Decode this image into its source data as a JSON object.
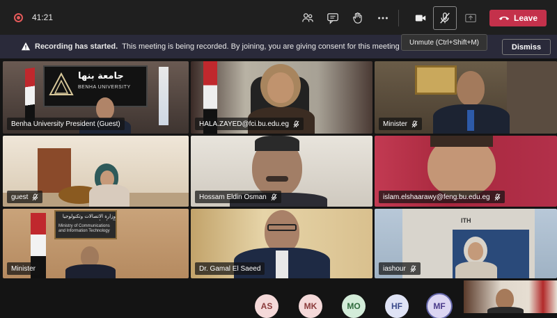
{
  "topbar": {
    "timer": "41:21",
    "leave_label": "Leave",
    "tooltip": "Unmute (Ctrl+Shift+M)"
  },
  "notice": {
    "title": "Recording has started.",
    "message": "This meeting is being recorded. By joining, you are giving consent for this meeting to be r",
    "dismiss_label": "Dismiss"
  },
  "participants": [
    {
      "name": "Benha University President (Guest)"
    },
    {
      "name": "HALA.ZAYED@fci.bu.edu.eg"
    },
    {
      "name": "Minister"
    },
    {
      "name": "guest"
    },
    {
      "name": "Hossam Eldin Osman"
    },
    {
      "name": "islam.elshaarawy@feng.bu.edu.eg"
    },
    {
      "name": "Minister"
    },
    {
      "name": "Dr. Gamal El Saeed"
    },
    {
      "name": "iashour"
    }
  ],
  "tile_texts": {
    "benha_sign_ar": "جامعة بنها",
    "benha_sign_en": "BENHA UNIVERSITY",
    "ministry_sign_ar": "وزارة الاتصالات وتكنولوجيا المعلومات",
    "ministry_sign_en": "Ministry of Communications and Information Technology",
    "building_sign": "ITH"
  },
  "avatars": [
    {
      "initials": "AS",
      "bg": "#f4d9d9",
      "fg": "#8a3a3a"
    },
    {
      "initials": "MK",
      "bg": "#f4d9d9",
      "fg": "#8a3a3a"
    },
    {
      "initials": "MO",
      "bg": "#d3ecd9",
      "fg": "#2f6b3d"
    },
    {
      "initials": "HF",
      "bg": "#dfe3f5",
      "fg": "#3a4a8a"
    },
    {
      "initials": "MF",
      "bg": "#dcd6f2",
      "fg": "#4a3a8a",
      "speaking": true
    }
  ],
  "colors": {
    "leave": "#c4314b",
    "accent": "#6264a7",
    "recording": "#e35a5a"
  }
}
